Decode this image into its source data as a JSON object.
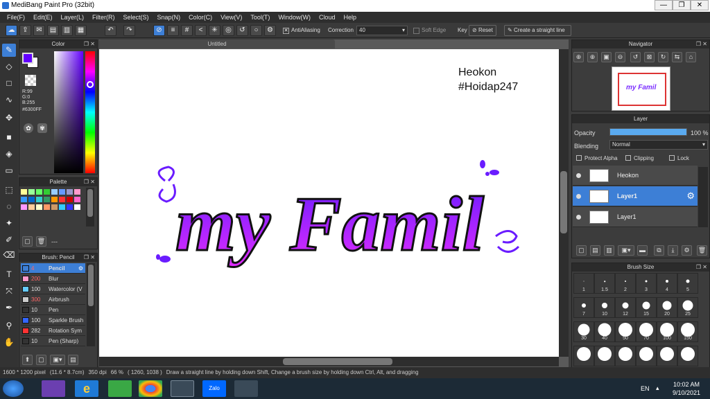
{
  "window": {
    "title": "MediBang Paint Pro (32bit)"
  },
  "menu": [
    "File(F)",
    "Edit(E)",
    "Layer(L)",
    "Filter(R)",
    "Select(S)",
    "Snap(N)",
    "Color(C)",
    "View(V)",
    "Tool(T)",
    "Window(W)",
    "Cloud",
    "Help"
  ],
  "toolbar": {
    "antialiasing_label": "AntiAliasing",
    "correction_label": "Correction",
    "correction_value": "40",
    "soft_edge_label": "Soft Edge",
    "key_label": "Key",
    "reset_label": "Reset",
    "straight_line_label": "Create a straight line"
  },
  "color_panel": {
    "title": "Color",
    "r": "R:99",
    "g": "G:0",
    "b": "B:255",
    "hex": "#6300FF",
    "primary_color": "#6300FF",
    "secondary_color": "#ffffff"
  },
  "palette_panel": {
    "title": "Palette",
    "colors": [
      "#ffff99",
      "#99ff99",
      "#66ff66",
      "#33cc33",
      "#99ccff",
      "#6699ff",
      "#9999cc",
      "#ff99cc",
      "#3399ff",
      "#0066cc",
      "#33cccc",
      "#339966",
      "#ff9900",
      "#ff3333",
      "#cc0000",
      "#ff66cc",
      "#ff99ff",
      "#ffcc99",
      "#ffffcc",
      "#ff9966",
      "#cc9966",
      "#33ccff",
      "#3333ff",
      "#ffffff"
    ],
    "footer_text": "---"
  },
  "brush_panel": {
    "title": "Brush: Pencil",
    "items": [
      {
        "size": "4",
        "name": "Pencil",
        "color": "#3d7fd6"
      },
      {
        "size": "200",
        "name": "Blur",
        "color": "#ff99cc"
      },
      {
        "size": "100",
        "name": "Watercolor (V",
        "color": "#66ccff"
      },
      {
        "size": "300",
        "name": "Airbrush",
        "color": "#cccccc"
      },
      {
        "size": "10",
        "name": "Pen",
        "color": "#333333"
      },
      {
        "size": "100",
        "name": "Sparkle Brush",
        "color": "#3366ff"
      },
      {
        "size": "282",
        "name": "Rotation Sym",
        "color": "#ff3333"
      },
      {
        "size": "10",
        "name": "Pen (Sharp)",
        "color": "#333333"
      }
    ]
  },
  "document": {
    "tab_title": "Untitled",
    "text_line1": "Heokon",
    "text_line2": "#Hoidap247",
    "artwork_text": "my Famil"
  },
  "navigator": {
    "title": "Navigator"
  },
  "layer_panel": {
    "title": "Layer",
    "opacity_label": "Opacity",
    "opacity_value": "100 %",
    "opacity_fraction": 1.0,
    "blending_label": "Blending",
    "blending_value": "Normal",
    "protect_alpha": "Protect Alpha",
    "clipping": "Clipping",
    "lock": "Lock",
    "layers": [
      {
        "name": "Heokon",
        "selected": false
      },
      {
        "name": "Layer1",
        "selected": true
      },
      {
        "name": "Layer1",
        "selected": false
      }
    ]
  },
  "brush_size_panel": {
    "title": "Brush Size",
    "sizes": [
      "1",
      "1.5",
      "2",
      "3",
      "4",
      "5",
      "7",
      "10",
      "12",
      "15",
      "20",
      "25",
      "30",
      "40",
      "50",
      "70",
      "100",
      "150",
      "",
      "",
      "",
      "",
      "",
      ""
    ]
  },
  "status": {
    "dimensions": "1600 * 1200 pixel",
    "physical": "(11.6 * 8.7cm)",
    "dpi": "350 dpi",
    "zoom": "66 %",
    "coords": "( 1260, 1038 )",
    "hint": "Draw a straight line by holding down Shift, Change a brush size by holding down Ctrl, Alt, and dragging"
  },
  "taskbar": {
    "language": "EN",
    "time": "10:02 AM",
    "date": "9/10/2021",
    "zalo_label": "Zalo"
  }
}
